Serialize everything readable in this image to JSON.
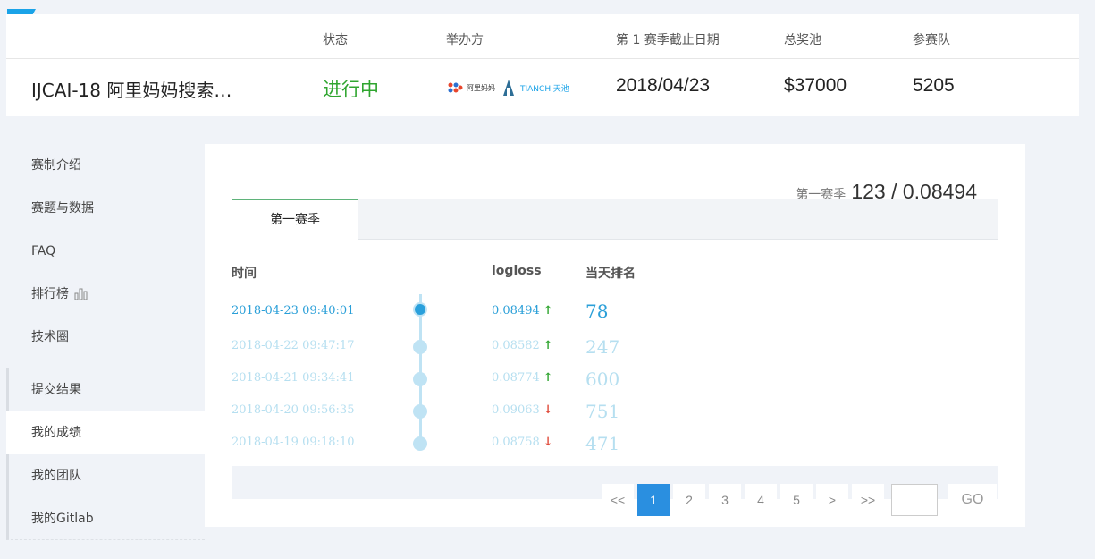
{
  "brand": {
    "accent": "#1aa3e8"
  },
  "header": {
    "labels": {
      "status": "状态",
      "organizer": "举办方",
      "deadline": "第 1 赛季截止日期",
      "prize": "总奖池",
      "teams": "参赛队"
    },
    "competition_title": "IJCAI-18 阿里妈妈搜索…",
    "status": "进行中",
    "organizers": [
      "阿里妈妈",
      "TIANCHI天池"
    ],
    "deadline": "2018/04/23",
    "prize": "$37000",
    "teams": "5205"
  },
  "sidebar": {
    "items": [
      {
        "label": "赛制介绍"
      },
      {
        "label": "赛题与数据"
      },
      {
        "label": "FAQ"
      },
      {
        "label": "排行榜"
      },
      {
        "label": "技术圈"
      }
    ],
    "sub_items": [
      {
        "label": "提交结果"
      },
      {
        "label": "我的成绩"
      },
      {
        "label": "我的团队"
      },
      {
        "label": "我的Gitlab"
      }
    ]
  },
  "main": {
    "season_label": "第一赛季",
    "season_score": "123 / 0.08494",
    "tab_label": "第一赛季",
    "columns": {
      "time": "时间",
      "logloss": "logloss",
      "rank": "当天排名"
    },
    "rows": [
      {
        "time": "2018-04-23 09:40:01",
        "logloss": "0.08494",
        "trend": "up",
        "rank": "78"
      },
      {
        "time": "2018-04-22 09:47:17",
        "logloss": "0.08582",
        "trend": "up",
        "rank": "247"
      },
      {
        "time": "2018-04-21 09:34:41",
        "logloss": "0.08774",
        "trend": "up",
        "rank": "600"
      },
      {
        "time": "2018-04-20 09:56:35",
        "logloss": "0.09063",
        "trend": "down",
        "rank": "751"
      },
      {
        "time": "2018-04-19 09:18:10",
        "logloss": "0.08758",
        "trend": "down",
        "rank": "471"
      }
    ],
    "pagination": {
      "first": "<<",
      "pages": [
        "1",
        "2",
        "3",
        "4",
        "5"
      ],
      "next": ">",
      "last": ">>",
      "go": "GO"
    }
  }
}
